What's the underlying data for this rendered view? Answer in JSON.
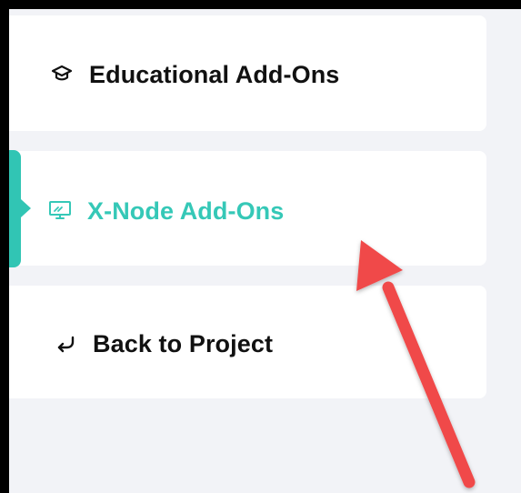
{
  "sidebar": {
    "items": [
      {
        "label": "Educational Add-Ons",
        "icon": "graduation-cap-icon"
      },
      {
        "label": "X-Node Add-Ons",
        "icon": "monitor-icon",
        "active": true
      },
      {
        "label": "Back to Project",
        "icon": "return-arrow-icon"
      }
    ]
  },
  "colors": {
    "background": "#f2f3f7",
    "active": "#31c5b4",
    "text": "#111111",
    "annotation": "#f04a4a"
  }
}
